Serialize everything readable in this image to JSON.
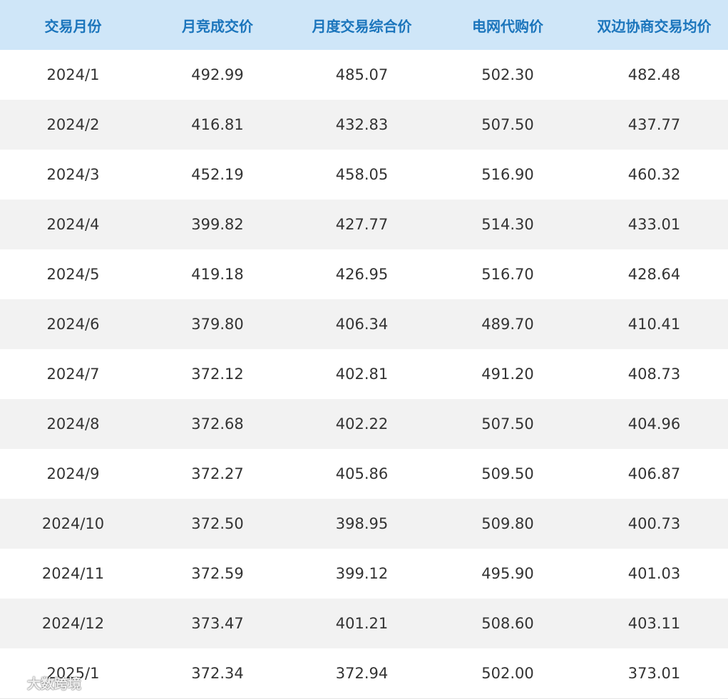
{
  "table": {
    "headers": [
      "交易月份",
      "月竞成交价",
      "月度交易综合价",
      "电网代购价",
      "双边协商交易均价"
    ],
    "rows": [
      [
        "2024/1",
        "492.99",
        "485.07",
        "502.30",
        "482.48"
      ],
      [
        "2024/2",
        "416.81",
        "432.83",
        "507.50",
        "437.77"
      ],
      [
        "2024/3",
        "452.19",
        "458.05",
        "516.90",
        "460.32"
      ],
      [
        "2024/4",
        "399.82",
        "427.77",
        "514.30",
        "433.01"
      ],
      [
        "2024/5",
        "419.18",
        "426.95",
        "516.70",
        "428.64"
      ],
      [
        "2024/6",
        "379.80",
        "406.34",
        "489.70",
        "410.41"
      ],
      [
        "2024/7",
        "372.12",
        "402.81",
        "491.20",
        "408.73"
      ],
      [
        "2024/8",
        "372.68",
        "402.22",
        "507.50",
        "404.96"
      ],
      [
        "2024/9",
        "372.27",
        "405.86",
        "509.50",
        "406.87"
      ],
      [
        "2024/10",
        "372.50",
        "398.95",
        "509.80",
        "400.73"
      ],
      [
        "2024/11",
        "372.59",
        "399.12",
        "495.90",
        "401.03"
      ],
      [
        "2024/12",
        "373.47",
        "401.21",
        "508.60",
        "403.11"
      ],
      [
        "2025/1",
        "372.34",
        "372.94",
        "502.00",
        "373.01"
      ]
    ]
  },
  "watermark": {
    "text": "大数跨境",
    "icon": "brand-logo-icon"
  },
  "colors": {
    "header_bg": "#cfe6f8",
    "header_text": "#1b75bc",
    "row_alt_bg": "#f2f2f2",
    "cell_text": "#333333"
  }
}
